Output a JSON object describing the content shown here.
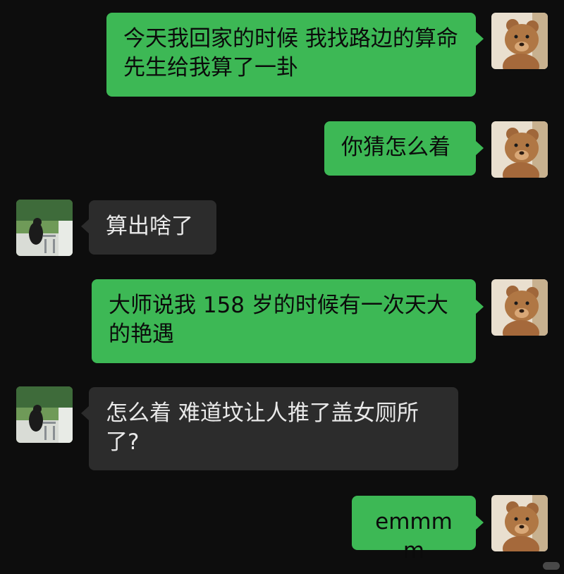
{
  "chat": {
    "messages": [
      {
        "sender": "me",
        "text": "今天我回家的时候 我找路边的算命先生给我算了一卦"
      },
      {
        "sender": "me",
        "text": "你猜怎么着"
      },
      {
        "sender": "them",
        "text": "算出啥了"
      },
      {
        "sender": "me",
        "text": "大师说我 158 岁的时候有一次天大的艳遇"
      },
      {
        "sender": "them",
        "text": "怎么着 难道坟让人推了盖女厕所了?"
      },
      {
        "sender": "me",
        "text": "emmmm"
      }
    ]
  },
  "colors": {
    "background": "#0d0d0d",
    "my_bubble": "#3db855",
    "their_bubble": "#2c2c2c"
  },
  "avatars": {
    "me": "teddy-bear-avatar",
    "them": "outdoor-photo-avatar"
  }
}
